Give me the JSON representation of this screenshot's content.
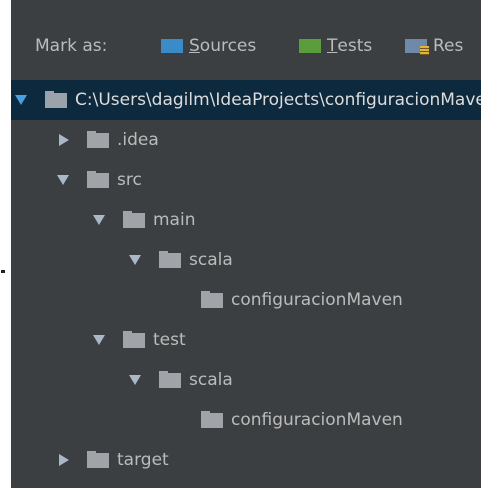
{
  "toolbar": {
    "mark_as_label": "Mark as:",
    "buttons": [
      {
        "label_first": "S",
        "label_rest": "ources",
        "icon": "folder-sources-icon",
        "color": "#3b8bc8"
      },
      {
        "label_first": "T",
        "label_rest": "ests",
        "icon": "folder-tests-icon",
        "color": "#5b9c3c"
      },
      {
        "label_first": "",
        "label_rest": "Res",
        "icon": "folder-resources-icon",
        "color": "#6e8aa8"
      }
    ]
  },
  "tree": {
    "items": [
      {
        "label": "C:\\Users\\dagilm\\IdeaProjects\\configuracionMaven",
        "expanded": true,
        "selected": true
      },
      {
        "label": ".idea",
        "expanded": false
      },
      {
        "label": "src",
        "expanded": true
      },
      {
        "label": "main",
        "expanded": true
      },
      {
        "label": "scala",
        "expanded": true
      },
      {
        "label": "configuracionMaven",
        "leaf": true
      },
      {
        "label": "test",
        "expanded": true
      },
      {
        "label": "scala",
        "expanded": true
      },
      {
        "label": "configuracionMaven",
        "leaf": true
      },
      {
        "label": "target",
        "expanded": false
      }
    ]
  },
  "colors": {
    "background": "#3c3f41",
    "selection": "#0d293e",
    "text": "#bbbbbb",
    "sources": "#3b8bc8",
    "tests": "#5b9c3c"
  }
}
